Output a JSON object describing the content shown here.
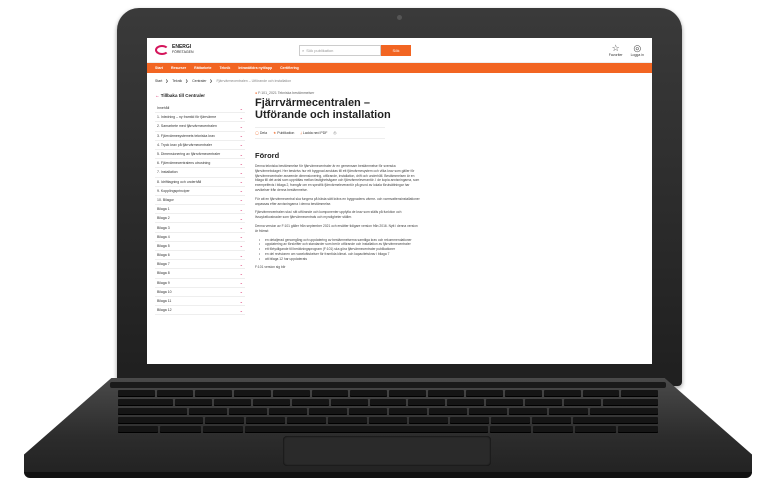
{
  "site": {
    "logo_line1": "ENERGI",
    "logo_line2": "FÖRETAGEN",
    "search_placeholder": "Sök publikation",
    "search_button": "Sök",
    "favorites": "Favoriter",
    "login": "Logga in"
  },
  "nav": [
    "Start",
    "Resurser",
    "Rättarbete",
    "Teknik",
    "Intranät/dra nytt/app",
    "Certifiering"
  ],
  "breadcrumb": [
    "Start",
    "Teknik",
    "Centraler",
    "Fjärrvärmecentralen – Utförande och installation"
  ],
  "sidebar": {
    "back": "Tillbaka till Centraler",
    "items": [
      "Innehåll",
      "1. Inledning – ny framtid för fjärrvärme",
      "2. Samarbete med fjärrvärmecentralen",
      "3. Fjärrvärmesystemets tekniska krav",
      "4. Tryck krav på fjärrvärmecentraler",
      "5. Dimensionering av fjärrvärmecentraler",
      "6. Fjärrvärmecentralens utrustning",
      "7. Installation",
      "8. Idrifttagning och underhåll",
      "9. Kopplingsprinciper",
      "10. Bilagor",
      "Bilaga 1",
      "Bilaga 2",
      "Bilaga 3",
      "Bilaga 4",
      "Bilaga 5",
      "Bilaga 6",
      "Bilaga 7",
      "Bilaga 8",
      "Bilaga 9",
      "Bilaga 10",
      "Bilaga 11",
      "Bilaga 12"
    ]
  },
  "article": {
    "tag": "F:101_2021 Tekniska bestämmelser",
    "title": "Fjärrvärmecentralen – Utförande och installation",
    "actions": [
      "Dela",
      "Publikation",
      "Ladda ned PDF"
    ],
    "heading": "Förord",
    "paragraphs": [
      "Denna tekniska bestämmelse för fjärrvärmecentraler är en gemensam bestämmelse för svenska fjärrvärmebolaget. Her beskrivs hur ett byggnad anslutas till ett fjärrvärmesystem och vilka krav som gäller för fjärrvärmecentraler avseende dimensionering, utförande, installation, drift och underhåll. Bestämmelsen är en bilaga till det avtal som upprättas mellan fastighetsägare och fjärrvärmeleverantör. I de kopia anvisningarna, som exempelfevis i bilaga 2, framgår om en specifik fjärrvärmeleverantör på grund av lokala förutsättningar har avvikelser från denna bestämmelse.",
      "För att en fjärrvärmecentral ska fungera på bästa sätt krävs en byggnadens värme- och varmvattensinstallationer anpassas efter anvisningarna i denna bestämmelse.",
      "Fjärrvärmecentralen ska i sitt utförande och komponenter uppfylla de krav som ställs på funktion och livscykelkostnader som fjärrvärmecentrals och myndigheter ställer.",
      "Denna version av F:101 gäller från september 2021 och ersätter tidigare version från 2016. Nytt i denna version är främst:"
    ],
    "bullets": [
      "en detaljerad genomgång och uppdatering av bestämmelserna samtliga krav och rekommendationer",
      "uppdatering av förskrifter och standarder som berör utförande och installation av fjärrvärmecentraler",
      "ett förtydligande till beräkningsprogram (F:101) ska göra fjärrvärmecentraler publikationer",
      "en del revisionen om vaxelvätskelser för framtida klimat- och kapacitetskrav i bilaga 7",
      "att bilaga 12 har uppdaterats"
    ],
    "footer_text": "F:101 version sig blir"
  }
}
